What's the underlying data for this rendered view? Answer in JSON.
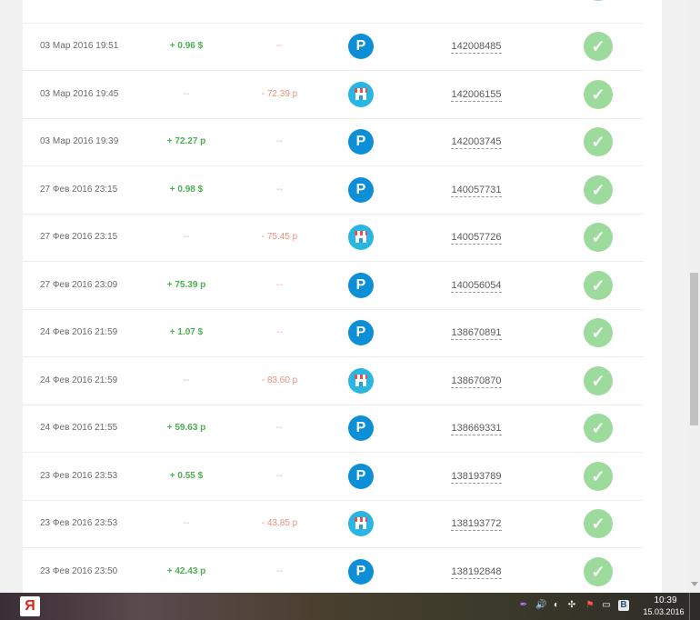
{
  "transactions": [
    {
      "date": "03 Мар 2016 19:51",
      "income": "+ 0.96 $",
      "expense": "--",
      "method": "payeer-icon",
      "id": "142008485"
    },
    {
      "date": "03 Мар 2016 19:45",
      "income": "--",
      "expense": "- 72.39 р",
      "method": "shop-icon",
      "id": "142006155"
    },
    {
      "date": "03 Мар 2016 19:39",
      "income": "+ 72.27 р",
      "expense": "--",
      "method": "payeer-icon",
      "id": "142003745"
    },
    {
      "date": "27 Фев 2016 23:15",
      "income": "+ 0.98 $",
      "expense": "--",
      "method": "payeer-icon",
      "id": "140057731"
    },
    {
      "date": "27 Фев 2016 23:15",
      "income": "--",
      "expense": "- 75.45 р",
      "method": "shop-icon",
      "id": "140057726"
    },
    {
      "date": "27 Фев 2016 23:09",
      "income": "+ 75.39 р",
      "expense": "--",
      "method": "payeer-icon",
      "id": "140056054"
    },
    {
      "date": "24 Фев 2016 21:59",
      "income": "+ 1.07 $",
      "expense": "--",
      "method": "payeer-icon",
      "id": "138670891"
    },
    {
      "date": "24 Фев 2016 21:59",
      "income": "--",
      "expense": "- 83.60 р",
      "method": "shop-icon",
      "id": "138670870"
    },
    {
      "date": "24 Фев 2016 21:55",
      "income": "+ 59.63 р",
      "expense": "--",
      "method": "payeer-icon",
      "id": "138669331"
    },
    {
      "date": "23 Фев 2016 23:53",
      "income": "+ 0.55 $",
      "expense": "--",
      "method": "payeer-icon",
      "id": "138193789"
    },
    {
      "date": "23 Фев 2016 23:53",
      "income": "--",
      "expense": "- 43.85 р",
      "method": "shop-icon",
      "id": "138193772"
    },
    {
      "date": "23 Фев 2016 23:50",
      "income": "+ 42.43 р",
      "expense": "--",
      "method": "payeer-icon",
      "id": "138192848"
    }
  ],
  "labels": {
    "payeer_letter": "P",
    "check_glyph": "✓",
    "yandex_letter": "Я",
    "tray_vk": "В"
  },
  "taskbar": {
    "time": "10:39",
    "date": "15.03.2016"
  },
  "colors": {
    "income": "#4caf50",
    "expense": "#ef8f7d",
    "payeer": "#0d8fd8",
    "shop": "#29b6e3",
    "status_ok": "#9ddb9c"
  }
}
